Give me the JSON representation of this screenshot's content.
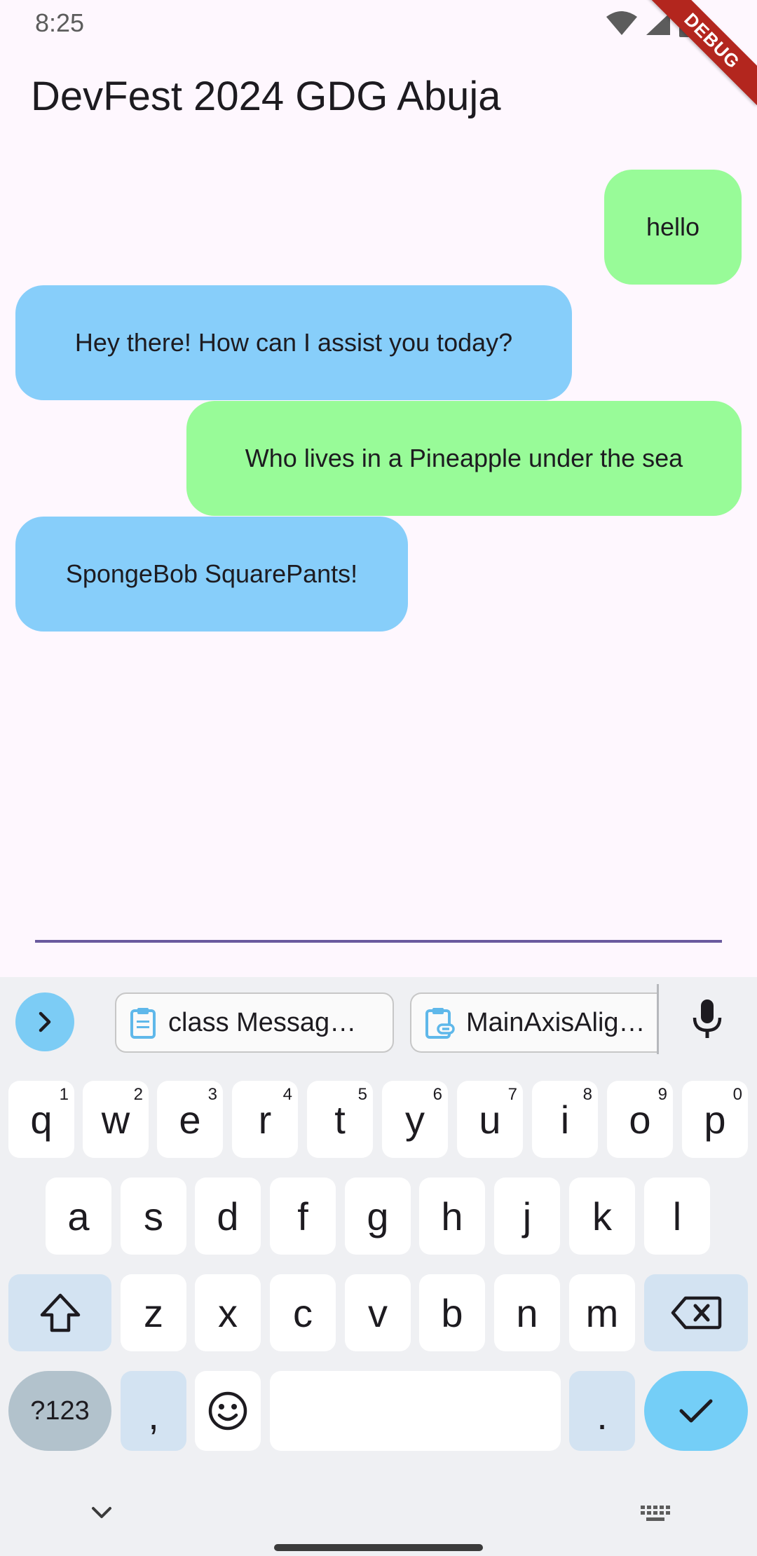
{
  "status": {
    "time": "8:25",
    "debug_label": "DEBUG"
  },
  "app": {
    "title": "DevFest 2024 GDG Abuja"
  },
  "messages": [
    {
      "sender": "user",
      "text": "hello"
    },
    {
      "sender": "bot",
      "text": "Hey there! How can I assist you today?"
    },
    {
      "sender": "user",
      "text": "Who lives in a Pineapple under the sea"
    },
    {
      "sender": "bot",
      "text": "SpongeBob SquarePants!"
    }
  ],
  "input": {
    "value": "",
    "placeholder": ""
  },
  "keyboard": {
    "clipboard_chips": [
      {
        "icon": "clipboard-icon",
        "text": "class Messag…"
      },
      {
        "icon": "clipboard-link-icon",
        "text": "MainAxisAlig…"
      }
    ],
    "row1": [
      {
        "k": "q",
        "h": "1"
      },
      {
        "k": "w",
        "h": "2"
      },
      {
        "k": "e",
        "h": "3"
      },
      {
        "k": "r",
        "h": "4"
      },
      {
        "k": "t",
        "h": "5"
      },
      {
        "k": "y",
        "h": "6"
      },
      {
        "k": "u",
        "h": "7"
      },
      {
        "k": "i",
        "h": "8"
      },
      {
        "k": "o",
        "h": "9"
      },
      {
        "k": "p",
        "h": "0"
      }
    ],
    "row2": [
      "a",
      "s",
      "d",
      "f",
      "g",
      "h",
      "j",
      "k",
      "l"
    ],
    "row3": [
      "z",
      "x",
      "c",
      "v",
      "b",
      "n",
      "m"
    ],
    "symbols_label": "?123",
    "comma": ",",
    "period": "."
  },
  "colors": {
    "background": "#fef7fe",
    "user_bubble": "#98fb98",
    "bot_bubble": "#87cefa",
    "input_underline": "#6a5a9e",
    "keyboard_bg": "#eff0f3",
    "accent": "#74cef7"
  }
}
